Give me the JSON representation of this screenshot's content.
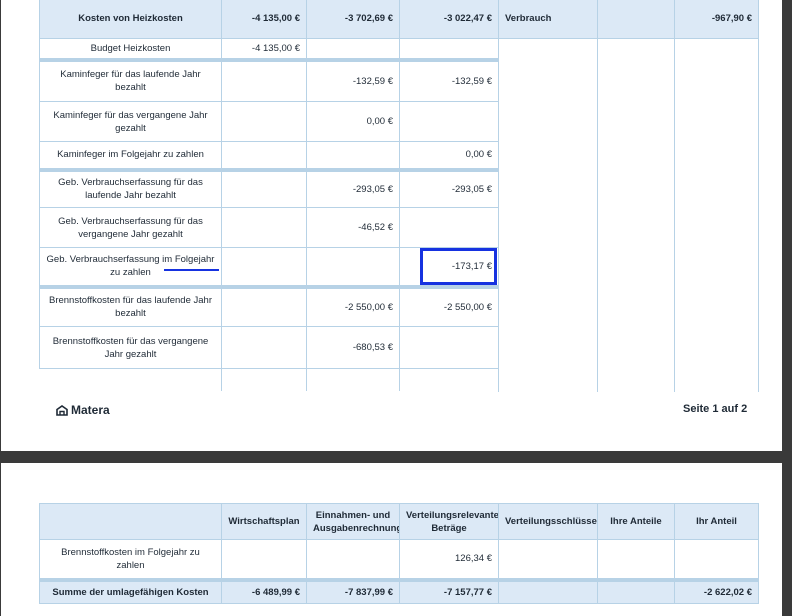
{
  "page1": {
    "header": {
      "label": "Kosten von Heizkosten",
      "plan": "-4 135,00 €",
      "income": "-3 702,69 €",
      "relevant": "-3 022,47 €",
      "key": "Verbrauch",
      "total": "-967,90 €"
    },
    "rows": [
      {
        "label": "Budget Heizkosten",
        "plan": "-4 135,00 €",
        "income": "",
        "relevant": ""
      },
      {
        "label": "Kaminfeger für das laufende Jahr bezahlt",
        "plan": "",
        "income": "-132,59 €",
        "relevant": "-132,59 €"
      },
      {
        "label": "Kaminfeger für das vergangene Jahr gezahlt",
        "plan": "",
        "income": "0,00 €",
        "relevant": ""
      },
      {
        "label": "Kaminfeger im Folgejahr zu zahlen",
        "plan": "",
        "income": "",
        "relevant": "0,00 €"
      },
      {
        "label": "Geb. Verbrauchserfassung für das laufende Jahr bezahlt",
        "plan": "",
        "income": "-293,05 €",
        "relevant": "-293,05 €"
      },
      {
        "label": "Geb. Verbrauchserfassung für das vergangene Jahr gezahlt",
        "plan": "",
        "income": "-46,52 €",
        "relevant": ""
      },
      {
        "label": "Geb. Verbrauchserfassung im Folgejahr zu zahlen",
        "plan": "",
        "income": "",
        "relevant": "-173,17 €"
      },
      {
        "label": "Brennstoffkosten für das laufende Jahr bezahlt",
        "plan": "",
        "income": "-2 550,00 €",
        "relevant": "-2 550,00 €"
      },
      {
        "label": "Brennstoffkosten für das vergangene Jahr gezahlt",
        "plan": "",
        "income": "-680,53 €",
        "relevant": ""
      }
    ],
    "footer": {
      "logo_text": "Matera",
      "page_number": "Seite 1 auf 2"
    }
  },
  "page2": {
    "columns": {
      "plan": "Wirtschaftsplan",
      "income": "Einnahmen- und Ausgabenrechnung",
      "relevant": "Verteilungsrelevante Beträge",
      "key": "Verteilungsschlüssel",
      "share": "Ihre Anteile",
      "my_share": "Ihr Anteil"
    },
    "rows": [
      {
        "label": "Brennstoffkosten im Folgejahr zu zahlen",
        "plan": "",
        "income": "",
        "relevant": "126,34 €"
      }
    ],
    "sum": {
      "label": "Summe der umlagefähigen Kosten",
      "plan": "-6 489,99 €",
      "income": "-7 837,99 €",
      "relevant": "-7 157,77 €",
      "total": "-2 622,02 €"
    }
  }
}
